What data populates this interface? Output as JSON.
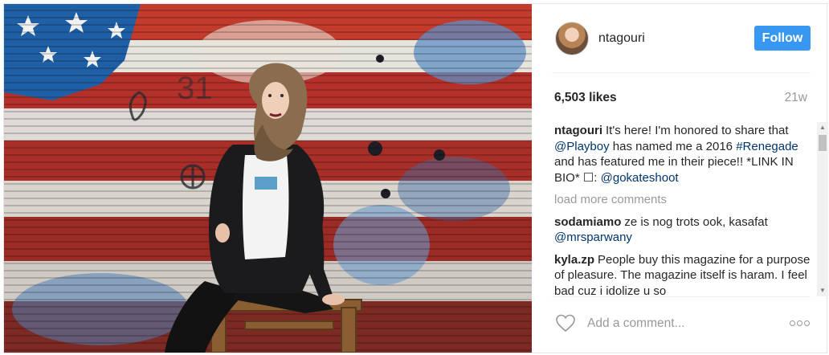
{
  "post": {
    "username": "ntagouri",
    "follow_label": "Follow",
    "likes": "6,503 likes",
    "time_ago": "21w"
  },
  "caption": {
    "user": "ntagouri",
    "t1": "It's here! I'm honored to share that ",
    "m1": "@Playboy",
    "t2": " has named me a 2016 ",
    "h1": "#Renegade",
    "t3": " and has featured me in their piece!! *LINK IN BIO* ☐: ",
    "m2": "@gokateshoot"
  },
  "load_more": "load more comments",
  "comments": [
    {
      "user": "sodamiamo",
      "t1": "ze is nog trots ook, kasafat ",
      "m1": "@mrsparwany"
    },
    {
      "user": "kyla.zp",
      "t1": "People buy this magazine for a purpose of pleasure. The magazine itself is haram. I feel bad cuz i idolize u so"
    }
  ],
  "add_comment_placeholder": "Add a comment...",
  "icons": {
    "heart": "heart-icon",
    "more": "more-options-icon",
    "avatar": "avatar"
  },
  "colors": {
    "follow": "#3897f0",
    "link": "#003569",
    "muted": "#999999"
  }
}
